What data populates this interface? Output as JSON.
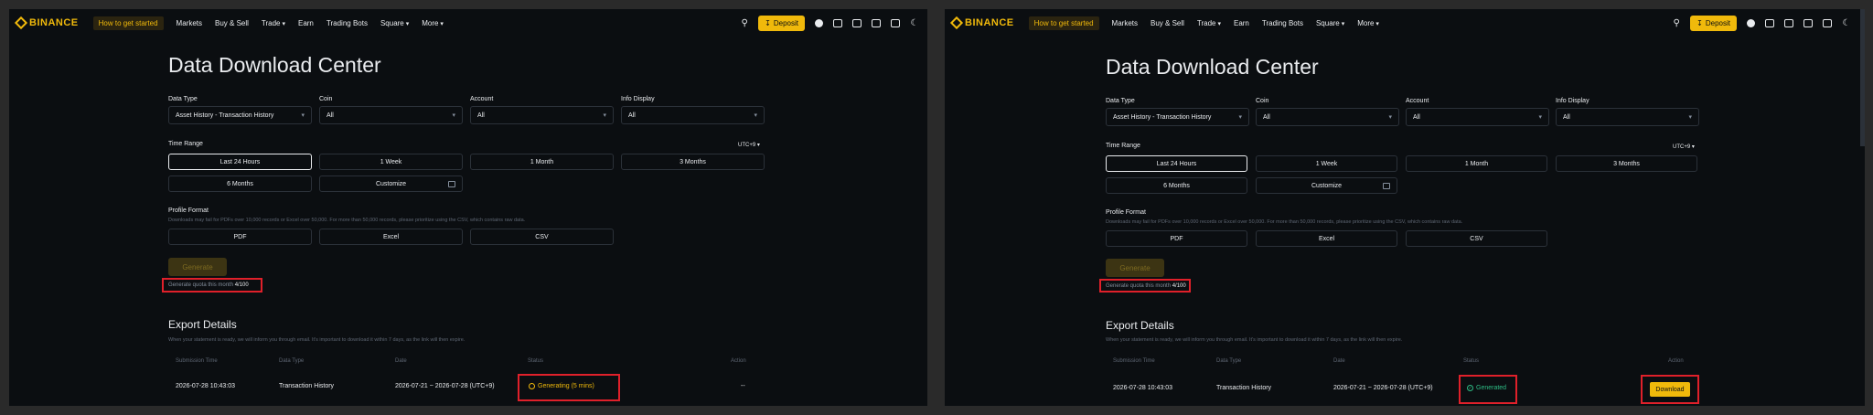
{
  "brand": "BINANCE",
  "nav": {
    "items": [
      "How to get started",
      "Markets",
      "Buy & Sell",
      "Trade",
      "Earn",
      "Trading Bots",
      "Square",
      "More"
    ],
    "deposit": "Deposit"
  },
  "page_title": "Data Download Center",
  "filters": {
    "data_type_label": "Data Type",
    "data_type_value": "Asset History - Transaction History",
    "coin_label": "Coin",
    "coin_value": "All",
    "account_label": "Account",
    "account_value": "All",
    "info_label": "Info Display",
    "info_value": "All"
  },
  "time_range": {
    "label": "Time Range",
    "tz": "UTC+9",
    "options": [
      "Last 24 Hours",
      "1 Week",
      "1 Month",
      "3 Months",
      "6 Months",
      "Customize"
    ]
  },
  "profile_format": {
    "label": "Profile Format",
    "hint": "Downloads may fail for PDFs over 10,000 records or Excel over 50,000. For more than 50,000 records, please prioritize using the CSV, which contains raw data.",
    "options": [
      "PDF",
      "Excel",
      "CSV"
    ]
  },
  "generate": {
    "button": "Generate",
    "quota_text": "Generate quota this month",
    "quota_value": "4/100"
  },
  "export": {
    "title": "Export Details",
    "hint": "When your statement is ready, we will inform you through email. It's important to download it within 7 days, as the link will then expire.",
    "headers": [
      "Submission Time",
      "Data Type",
      "Date",
      "Status",
      "Action"
    ],
    "row": {
      "submission_time": "2026-07-28 10:43:03",
      "data_type": "Transaction History",
      "date": "2026-07-21 ~ 2026-07-28 (UTC+9)"
    },
    "left_status": "Generating (5 mins)",
    "left_action": "--",
    "right_status": "Generated",
    "right_action": "Download"
  },
  "colors": {
    "accent": "#f0b90b",
    "success": "#2ebd85",
    "highlight": "#e0202a",
    "bg": "#0b0e11"
  }
}
